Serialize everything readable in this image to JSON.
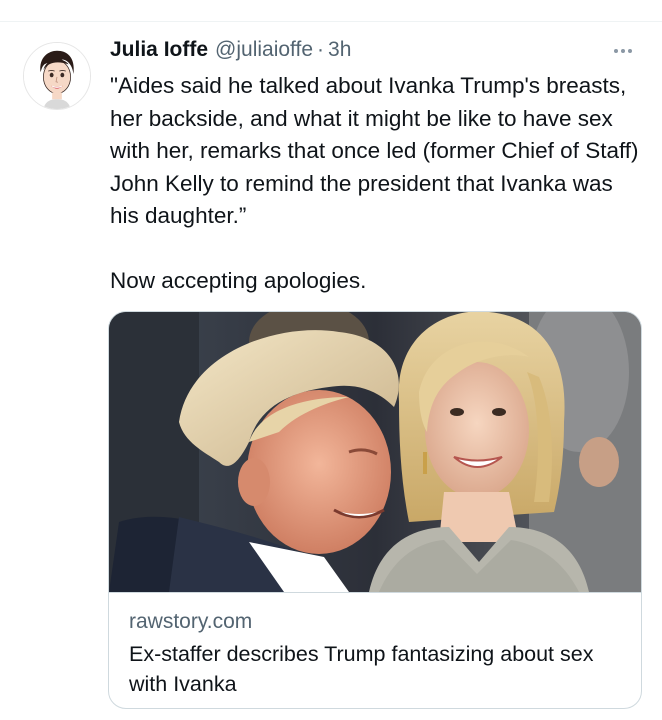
{
  "tweet": {
    "author": {
      "display_name": "Julia Ioffe",
      "handle": "@juliaioffe",
      "separator": "·",
      "time": "3h",
      "avatar_icon": "cartoon-portrait-avatar"
    },
    "more_icon": "more-dots-icon",
    "text_lines": [
      "\"Aides said he talked about Ivanka Trump's breasts, her backside, and what it might be like to have sex with her, remarks that once led (former Chief of Staff) John Kelly to remind the president that Ivanka was his daughter.”",
      "Now accepting apologies."
    ],
    "card": {
      "image_description": "photo-two-people-smiling",
      "domain": "rawstory.com",
      "title": "Ex-staffer describes Trump fantasizing about sex with Ivanka"
    }
  },
  "colors": {
    "text_primary": "#0f1419",
    "text_secondary": "#536471",
    "border": "#cfd9de"
  }
}
